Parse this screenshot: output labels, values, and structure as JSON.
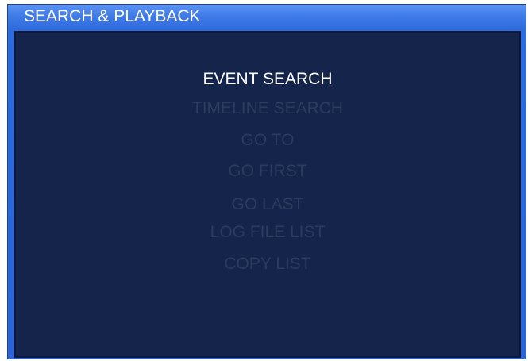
{
  "window": {
    "title": "SEARCH & PLAYBACK"
  },
  "menu": {
    "selected_index": 0,
    "items": [
      {
        "label": "EVENT SEARCH"
      },
      {
        "label": "TIMELINE SEARCH"
      },
      {
        "label": "GO TO"
      },
      {
        "label": "GO FIRST"
      },
      {
        "label": "GO LAST"
      },
      {
        "label": "LOG FILE LIST"
      },
      {
        "label": "COPY LIST"
      }
    ]
  },
  "colors": {
    "title_bar": "#3f7be8",
    "panel_background": "#14244a",
    "selected_text": "#ffffff",
    "unselected_text": "#2c3b5e"
  }
}
